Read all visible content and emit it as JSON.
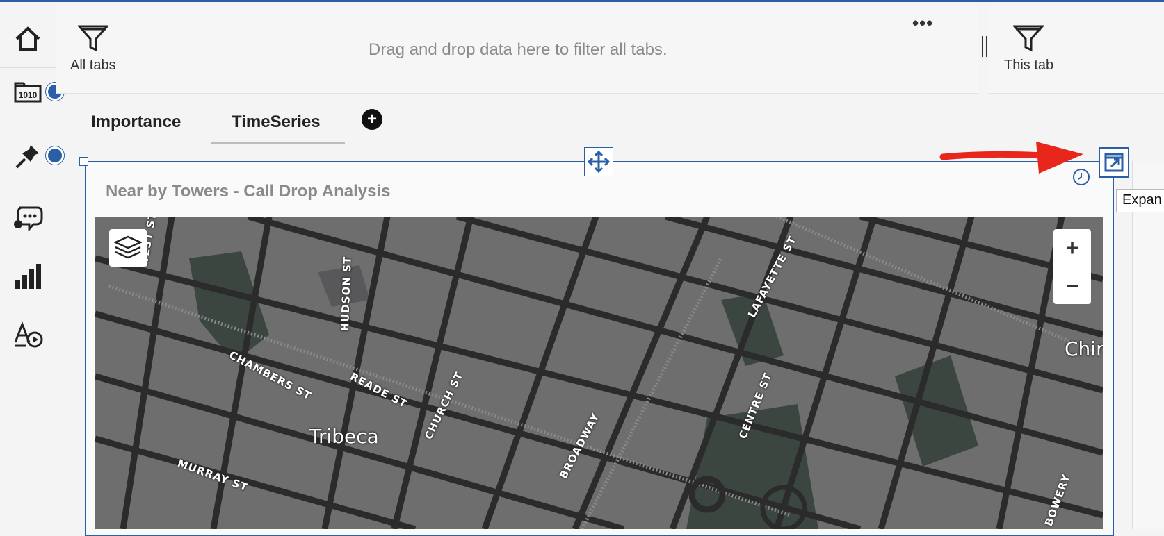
{
  "nav": {
    "items": [
      "home-icon",
      "data-source-icon",
      "pin-icon",
      "conversation-icon",
      "chart-icon",
      "animation-icon"
    ]
  },
  "filters": {
    "all_tabs_label": "All tabs",
    "drop_hint": "Drag and drop data here to filter all tabs.",
    "more_label": "•••",
    "this_tab_label": "This tab"
  },
  "tabs": [
    {
      "label": "Importance",
      "active": false
    },
    {
      "label": "TimeSeries",
      "active": true
    }
  ],
  "add_tab_label": "+",
  "widget": {
    "title": "Near by Towers - Call Drop Analysis",
    "expand_tooltip": "Expan"
  },
  "map": {
    "zoom_in": "+",
    "zoom_out": "−",
    "labels": {
      "west_st": "WEST ST",
      "hudson_st": "HUDSON ST",
      "lafayette_st": "LAFAYETTE ST",
      "chambers_st": "CHAMBERS ST",
      "reade_st": "READE ST",
      "church_st": "CHURCH ST",
      "centre_st": "CENTRE ST",
      "tribeca": "Tribeca",
      "broadway": "BROADWAY",
      "murray_st": "MURRAY ST",
      "bowery": "BOWERY",
      "chin": "Chin"
    }
  },
  "colors": {
    "accent": "#2a5fa8",
    "annotation_arrow": "#e8261c",
    "map_block": "#6f6e6f",
    "map_road": "#2b2b2b"
  }
}
